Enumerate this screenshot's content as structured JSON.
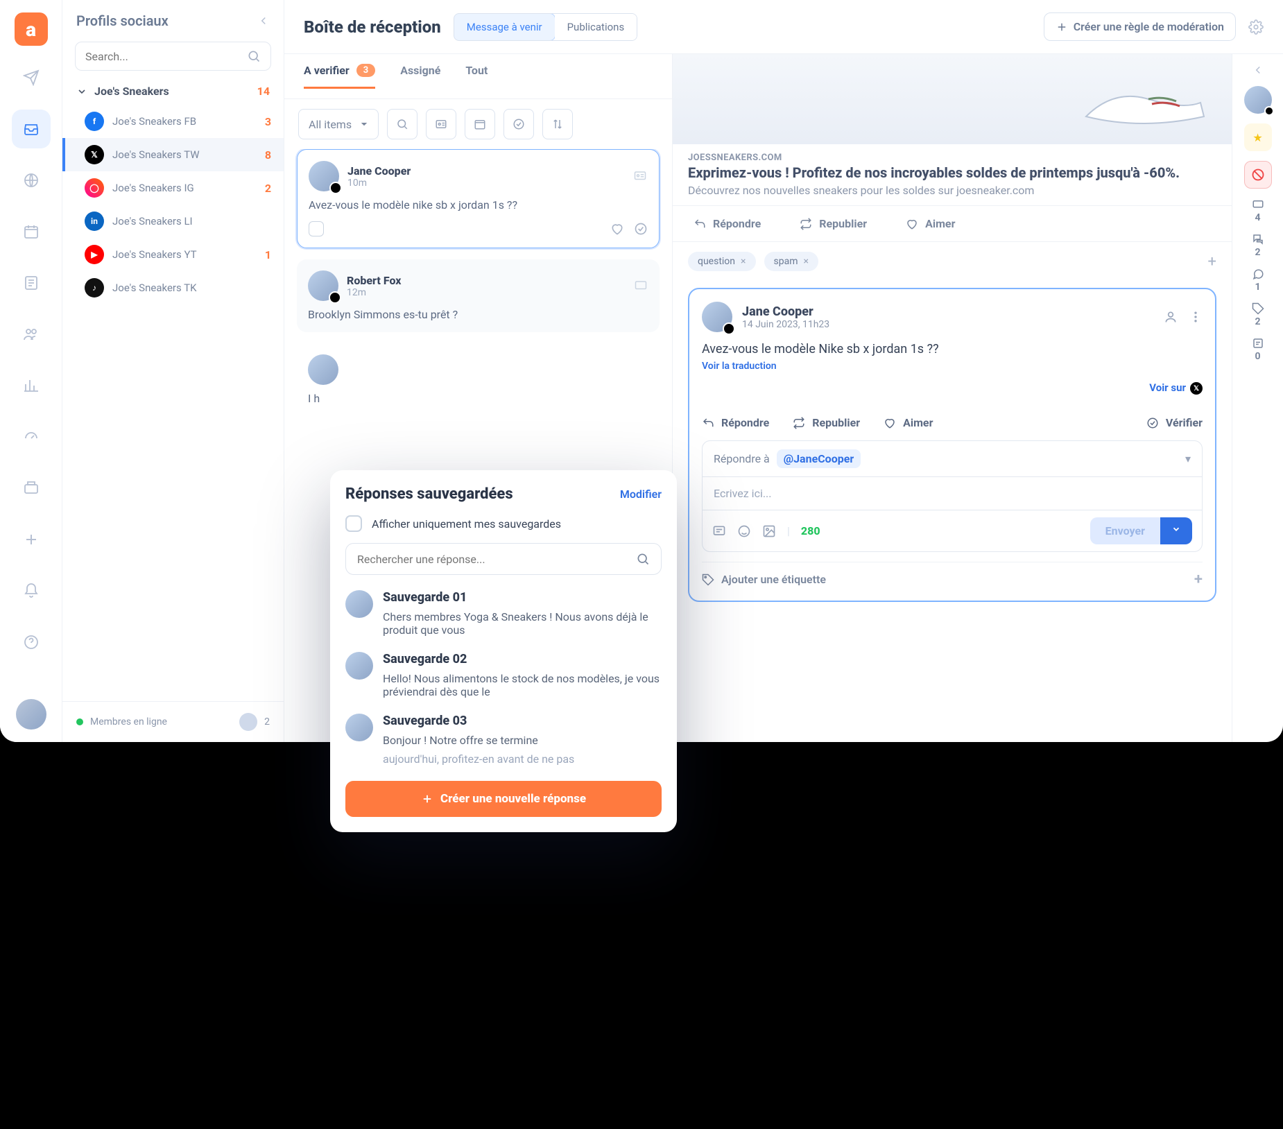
{
  "brand_letter": "a",
  "rail_icons": [
    "send",
    "inbox",
    "globe",
    "calendar",
    "note",
    "users",
    "chart",
    "gauge",
    "library",
    "plus",
    "bell",
    "help"
  ],
  "profiles_panel": {
    "title": "Profils sociaux",
    "search_placeholder": "Search...",
    "folder": {
      "name": "Joe's Sneakers",
      "count": "14"
    },
    "items": [
      {
        "name": "Joe's Sneakers FB",
        "count": "3",
        "network": "fb"
      },
      {
        "name": "Joe's Sneakers TW",
        "count": "8",
        "network": "tw"
      },
      {
        "name": "Joe's Sneakers IG",
        "count": "2",
        "network": "ig"
      },
      {
        "name": "Joe's Sneakers LI",
        "count": "",
        "network": "li"
      },
      {
        "name": "Joe's Sneakers YT",
        "count": "1",
        "network": "yt"
      },
      {
        "name": "Joe's Sneakers TK",
        "count": "",
        "network": "tk"
      }
    ],
    "online_label": "Membres en ligne",
    "online_count": "2"
  },
  "topbar": {
    "title": "Boîte de réception",
    "seg_upcoming": "Message à venir",
    "seg_posts": "Publications",
    "create_rule": "Créer une règle de modération"
  },
  "tabs": {
    "verify": "A verifier",
    "verify_badge": "3",
    "assigned": "Assigné",
    "all": "Tout"
  },
  "list_toolbar": {
    "filter_label": "All items"
  },
  "messages": [
    {
      "name": "Jane Cooper",
      "time": "10m",
      "text": "Avez-vous le modèle nike sb x jordan 1s ??"
    },
    {
      "name": "Robert Fox",
      "time": "12m",
      "text": "Brooklyn Simmons es-tu prêt ?"
    },
    {
      "name": "",
      "time": "",
      "text": "I h"
    }
  ],
  "post": {
    "domain": "JOESSNEAKERS.COM",
    "title": "Exprimez-vous ! Profitez de nos incroyables soldes de printemps jusqu'à -60%.",
    "subtitle": "Découvrez nos nouvelles sneakers pour les soldes sur joesneaker.com"
  },
  "actions": {
    "reply": "Répondre",
    "repost": "Republier",
    "like": "Aimer",
    "verify": "Vérifier"
  },
  "tags": [
    "question",
    "spam"
  ],
  "reply_card": {
    "name": "Jane Cooper",
    "date": "14 Juin 2023, 11h23",
    "body": "Avez-vous le modèle Nike sb x jordan 1s ??",
    "translate": "Voir la traduction",
    "view_on": "Voir sur",
    "reply_to_label": "Répondre à",
    "reply_to_handle": "@JaneCooper",
    "placeholder": "Ecrivez ici...",
    "char_count": "280",
    "send": "Envoyer",
    "add_tag": "Ajouter une étiquette"
  },
  "right_rail": {
    "metrics": [
      {
        "icon": "msg",
        "val": "4"
      },
      {
        "icon": "chat",
        "val": "2"
      },
      {
        "icon": "single",
        "val": "1"
      },
      {
        "icon": "tag",
        "val": "2"
      },
      {
        "icon": "task",
        "val": "0"
      }
    ]
  },
  "popover": {
    "title": "Réponses sauvegardées",
    "edit": "Modifier",
    "only_mine": "Afficher uniquement mes sauvegardes",
    "search_placeholder": "Rechercher une réponse...",
    "items": [
      {
        "title": "Sauvegarde 01",
        "body": "Chers membres Yoga & Sneakers ! Nous avons déjà le produit que vous"
      },
      {
        "title": "Sauvegarde 02",
        "body": "Hello! Nous alimentons le stock de nos modèles, je vous préviendrai dès que le"
      },
      {
        "title": "Sauvegarde 03",
        "body": "Bonjour ! Notre offre se termine",
        "body2": "aujourd'hui, profitez-en avant de ne pas"
      }
    ],
    "cta": "Créer une nouvelle réponse"
  }
}
